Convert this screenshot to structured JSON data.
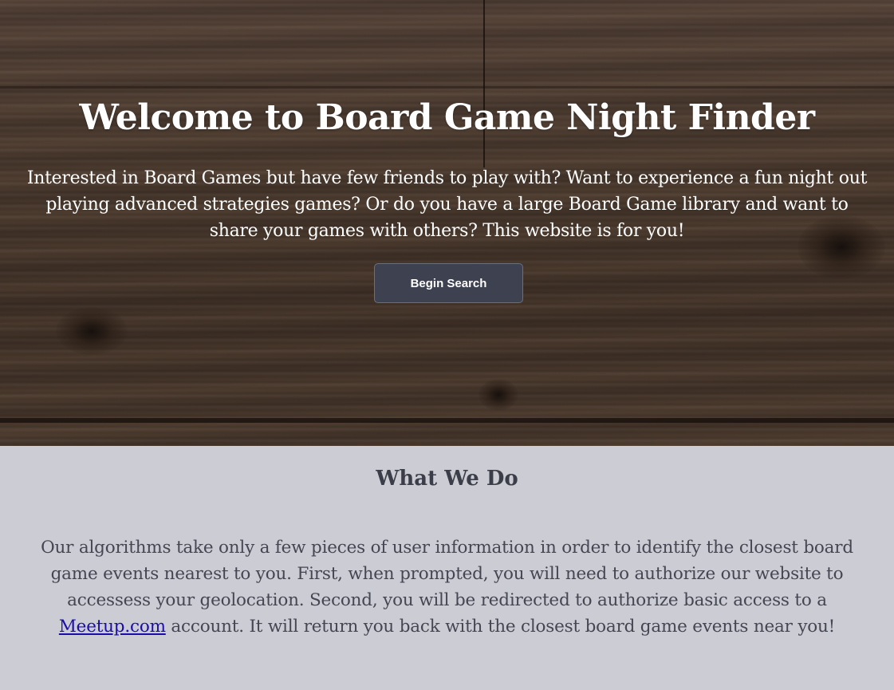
{
  "hero": {
    "title": "Welcome to Board Game Night Finder",
    "text": "Interested in Board Games but have few friends to play with? Want to experience a fun night out playing advanced strategies games? Or do you have a large Board Game library and want to share your games with others? This website is for you!",
    "button_label": "Begin Search"
  },
  "about": {
    "title": "What We Do",
    "text_before_link": "Our algorithms take only a few pieces of user information in order to identify the closest board game events nearest to you. First, when prompted, you will need to authorize our website to accessess your geolocation. Second, you will be redirected to authorize basic access to a ",
    "link_text": "Meetup.com",
    "text_after_link": " account. It will return you back with the closest board game events near you!"
  },
  "colors": {
    "hero_background": "#4a3a2e",
    "button_background": "#3d4150",
    "about_background": "#cbccd4",
    "about_text": "#454652",
    "link": "#1a0dab"
  }
}
